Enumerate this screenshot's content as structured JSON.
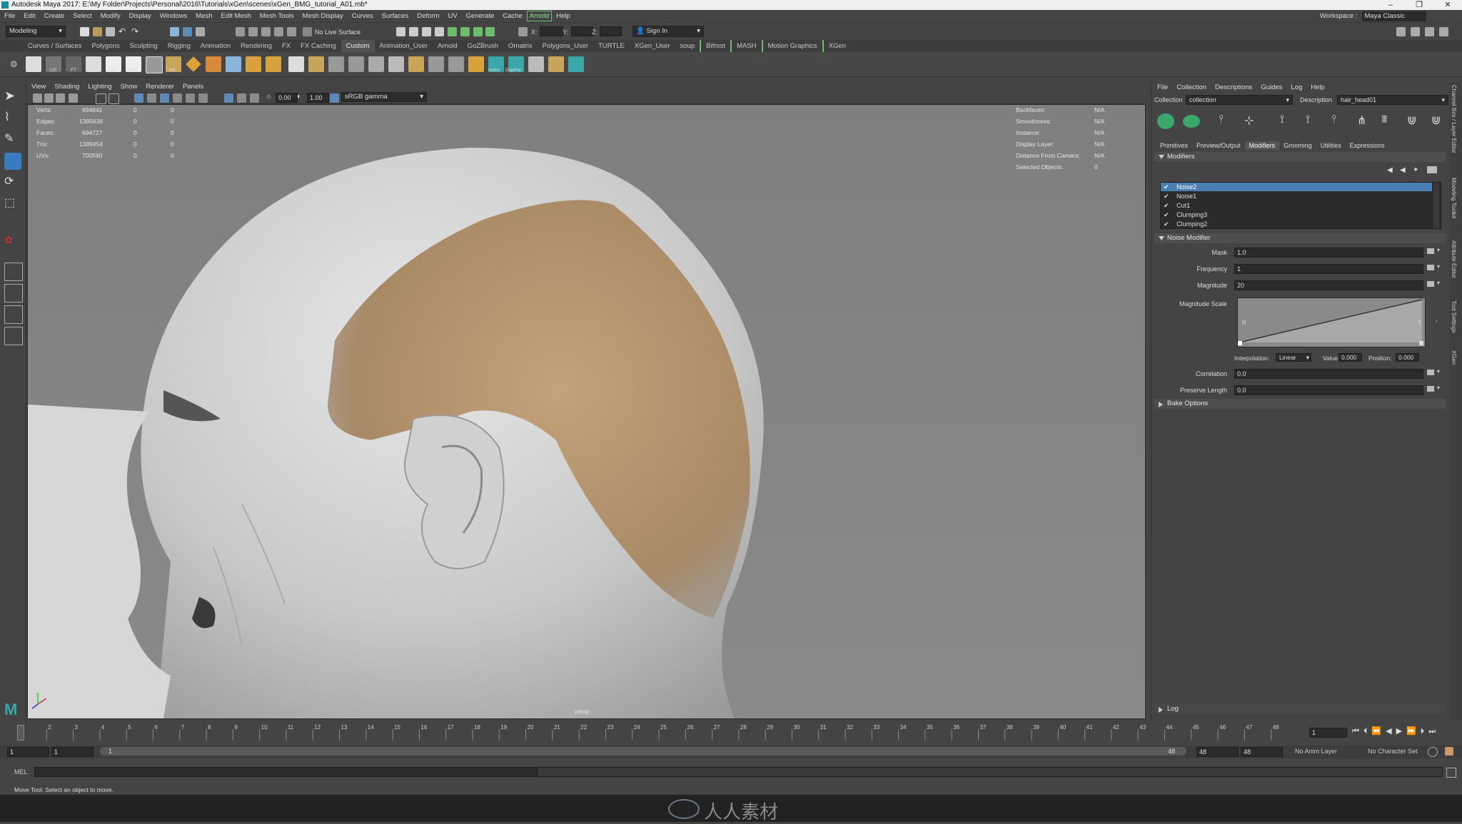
{
  "window": {
    "title": "Autodesk Maya 2017: E:\\My Folder\\Projects\\Personal\\2016\\Tutorials\\xGen\\scenes\\xGen_BMG_tutorial_A01.mb*",
    "minimize": "–",
    "maximize": "❐",
    "close": "✕"
  },
  "menus": [
    "File",
    "Edit",
    "Create",
    "Select",
    "Modify",
    "Display",
    "Windows",
    "Mesh",
    "Edit Mesh",
    "Mesh Tools",
    "Mesh Display",
    "Curves",
    "Surfaces",
    "Deform",
    "UV",
    "Generate",
    "Cache",
    "Arnold",
    "Help"
  ],
  "workspace": {
    "label": "Workspace :",
    "value": "Maya Classic"
  },
  "statusline": {
    "mode": "Modeling",
    "live_surface": "No Live Surface",
    "x_label": "X:",
    "y_label": "Y:",
    "z_label": "Z:",
    "sign_in": "Sign In"
  },
  "shelf_tabs": [
    "Curves / Surfaces",
    "Polygons",
    "Sculpting",
    "Rigging",
    "Animation",
    "Rendering",
    "FX",
    "FX Caching",
    "Custom",
    "Animation_User",
    "Arnold",
    "GoZBrush",
    "Ornatrix",
    "Polygons_User",
    "TURTLE",
    "XGen_User",
    "soup",
    "Bifrost",
    "MASH",
    "Motion Graphics",
    "XGen"
  ],
  "shelf_active": "Custom",
  "shelf_labels": [
    "Hist",
    "CP",
    "FT",
    "LRA",
    "Outl",
    "Hshd",
    "RE",
    "Unfro",
    "DopPat"
  ],
  "viewport": {
    "menus": [
      "View",
      "Shading",
      "Lighting",
      "Show",
      "Renderer",
      "Panels"
    ],
    "exposure": "0.00",
    "gamma": "1.00",
    "colorspace": "sRGB gamma",
    "camera": "persp",
    "hud_left": [
      {
        "label": "Verts:",
        "v1": "694841",
        "v2": "0",
        "v3": "0"
      },
      {
        "label": "Edges:",
        "v1": "1385636",
        "v2": "0",
        "v3": "0"
      },
      {
        "label": "Faces:",
        "v1": "694727",
        "v2": "0",
        "v3": "0"
      },
      {
        "label": "Tris:",
        "v1": "1389454",
        "v2": "0",
        "v3": "0"
      },
      {
        "label": "UVs:",
        "v1": "700590",
        "v2": "0",
        "v3": "0"
      }
    ],
    "hud_right": [
      {
        "label": "Backfaces:",
        "value": "N/A"
      },
      {
        "label": "Smoothness:",
        "value": "N/A"
      },
      {
        "label": "Instance:",
        "value": "N/A"
      },
      {
        "label": "Display Layer:",
        "value": "N/A"
      },
      {
        "label": "Distance From Camera:",
        "value": "N/A"
      },
      {
        "label": "Selected Objects:",
        "value": "0"
      }
    ]
  },
  "xgen": {
    "menus": [
      "File",
      "Collection",
      "Descriptions",
      "Guides",
      "Log",
      "Help"
    ],
    "collection_label": "Collection",
    "collection_value": "collection",
    "description_label": "Description",
    "description_value": "hair_head01",
    "tabs": [
      "Primitives",
      "Preview/Output",
      "Modifiers",
      "Grooming",
      "Utilities",
      "Expressions"
    ],
    "active_tab": "Modifiers",
    "modifiers_section": "Modifiers",
    "modifiers": [
      "Noise2",
      "Noise1",
      "Cut1",
      "Clumping3",
      "Clumping2"
    ],
    "selected_modifier": "Noise2",
    "noise_section": "Noise Modifier",
    "mask_label": "Mask",
    "mask_value": "1.0",
    "frequency_label": "Frequency",
    "frequency_value": "1",
    "magnitude_label": "Magnitude",
    "magnitude_value": "20",
    "magnitude_scale_label": "Magnitude Scale",
    "ramp_r": "R",
    "ramp_t": "T",
    "interpolation_label": "Interpolation:",
    "interpolation_value": "Linear",
    "value_label": "Value:",
    "value_value": "0.000",
    "position_label": "Position:",
    "position_value": "0.000",
    "correlation_label": "Correlation",
    "correlation_value": "0.0",
    "preserve_label": "Preserve Length",
    "preserve_value": "0.0",
    "bake_section": "Bake Options",
    "log_section": "Log"
  },
  "side_tabs": [
    "Channel Box / Layer Editor",
    "Modeling Toolkit",
    "Attribute Editor",
    "Tool Settings",
    "XGen"
  ],
  "timeline": {
    "ticks": [
      "1",
      "2",
      "3",
      "4",
      "5",
      "6",
      "7",
      "8",
      "9",
      "10",
      "11",
      "12",
      "13",
      "14",
      "15",
      "16",
      "17",
      "18",
      "19",
      "20",
      "21",
      "22",
      "23",
      "24",
      "25",
      "26",
      "27",
      "28",
      "29",
      "30",
      "31",
      "32",
      "33",
      "34",
      "35",
      "36",
      "37",
      "38",
      "39",
      "40",
      "41",
      "42",
      "43",
      "44",
      "45",
      "46",
      "47",
      "48"
    ],
    "current_frame": "1"
  },
  "range": {
    "start": "1",
    "start_inner": "1",
    "slider_start": "1",
    "slider_end": "48",
    "end_inner": "48",
    "end": "48",
    "anim_layer": "No Anim Layer",
    "char_set": "No Character Set"
  },
  "command_line": {
    "label": "MEL"
  },
  "help_line": "Move Tool: Select an object to move.",
  "watermark": "人人素材"
}
